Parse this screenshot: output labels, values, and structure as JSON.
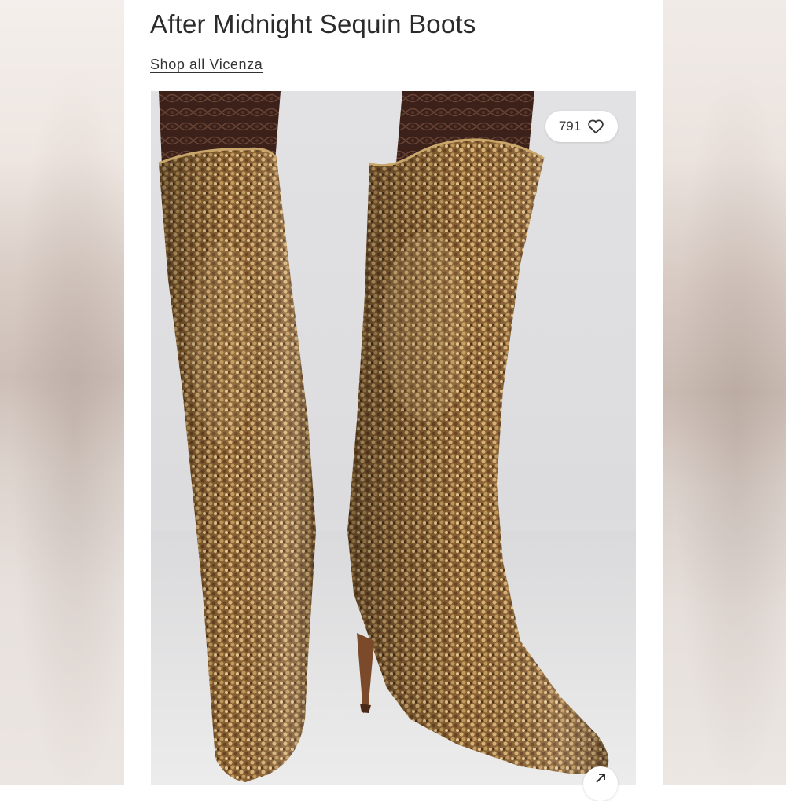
{
  "product": {
    "title": "After Midnight Sequin Boots",
    "brand_link": "Shop all Vicenza"
  },
  "image": {
    "alt": "After Midnight Sequin Boots",
    "likes": "791",
    "like_icon": "heart-icon",
    "expand_icon": "arrow-up-right-icon"
  },
  "colors": {
    "sequin_gold": "#b38a4e",
    "sequin_dark": "#5a3b1e",
    "tights": "#3a2118",
    "backdrop": "#dedee0"
  }
}
